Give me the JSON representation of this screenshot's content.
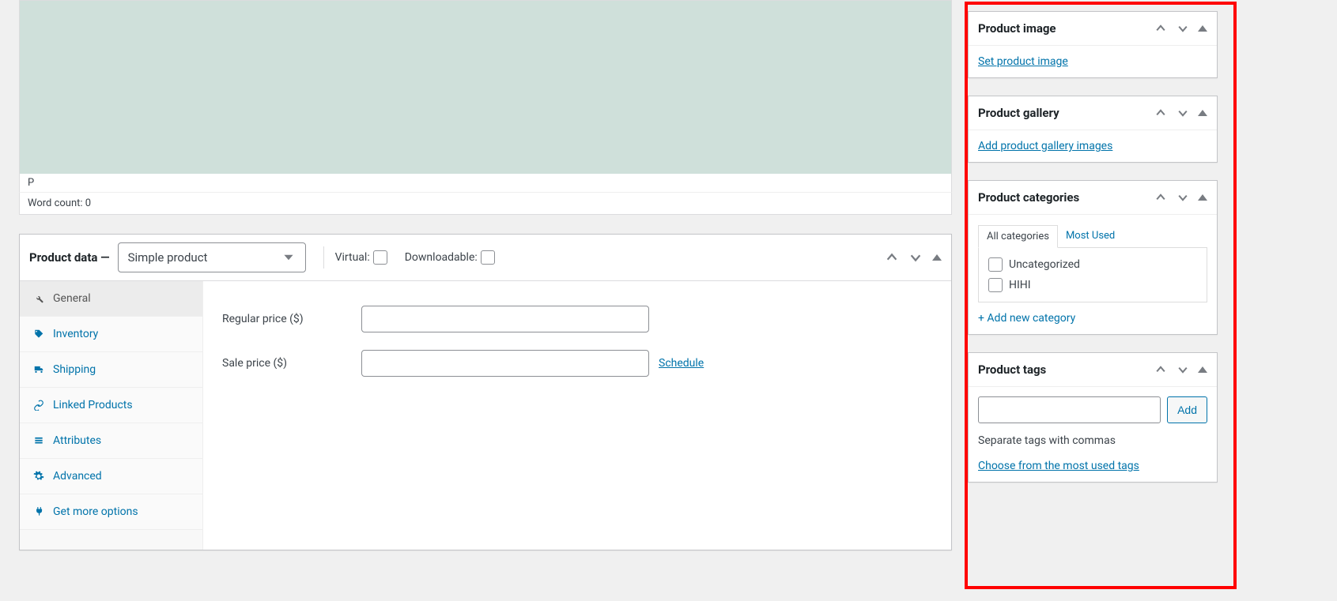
{
  "editor": {
    "path": "P",
    "word_count_label": "Word count: 0"
  },
  "product_data": {
    "title": "Product data —",
    "type_selected": "Simple product",
    "virtual_label": "Virtual:",
    "downloadable_label": "Downloadable:",
    "tabs": [
      {
        "key": "general",
        "label": "General"
      },
      {
        "key": "inventory",
        "label": "Inventory"
      },
      {
        "key": "shipping",
        "label": "Shipping"
      },
      {
        "key": "linked",
        "label": "Linked Products"
      },
      {
        "key": "attributes",
        "label": "Attributes"
      },
      {
        "key": "advanced",
        "label": "Advanced"
      },
      {
        "key": "getmore",
        "label": "Get more options"
      }
    ],
    "general": {
      "regular_price_label": "Regular price ($)",
      "sale_price_label": "Sale price ($)",
      "schedule_label": "Schedule"
    }
  },
  "sidebar": {
    "product_image": {
      "title": "Product image",
      "link": "Set product image"
    },
    "product_gallery": {
      "title": "Product gallery",
      "link": "Add product gallery images"
    },
    "product_categories": {
      "title": "Product categories",
      "tab_all": "All categories",
      "tab_most": "Most Used",
      "items": [
        "Uncategorized",
        "HIHI"
      ],
      "add_link": "+ Add new category"
    },
    "product_tags": {
      "title": "Product tags",
      "add_button": "Add",
      "hint": "Separate tags with commas",
      "choose_link": "Choose from the most used tags"
    }
  }
}
